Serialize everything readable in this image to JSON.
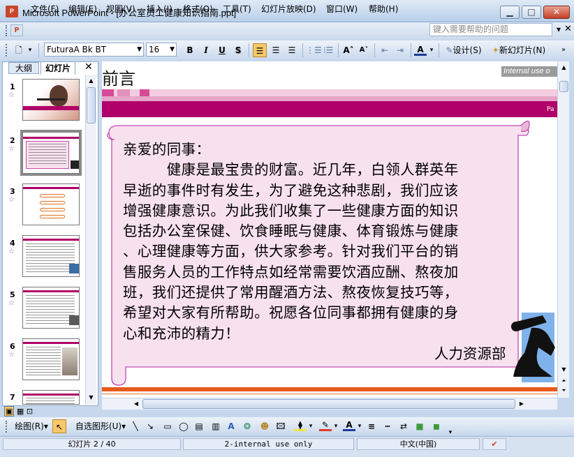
{
  "window": {
    "title": "Microsoft PowerPoint - [办公室员工健康知识指南.ppt]",
    "app_icon_text": "P",
    "btn_min": "▁",
    "btn_max": "□",
    "btn_close": "✕"
  },
  "menu": {
    "items": [
      "文件(F)",
      "编辑(E)",
      "视图(V)",
      "插入(I)",
      "格式(O)",
      "工具(T)",
      "幻灯片放映(D)",
      "窗口(W)",
      "帮助(H)"
    ],
    "help_placeholder": "键入需要帮助的问题"
  },
  "toolbar": {
    "font_name": "FuturaA Bk BT",
    "font_size": "16",
    "bold": "B",
    "italic": "I",
    "underline": "U",
    "shadow": "S",
    "design_label": "设计(S)",
    "new_slide_label": "新幻灯片(N)"
  },
  "left_pane": {
    "tab_outline": "大纲",
    "tab_slides": "幻灯片",
    "close": "✕",
    "slide_numbers": [
      "1",
      "2",
      "3",
      "4",
      "5",
      "6",
      "7"
    ]
  },
  "slide": {
    "title": "前言",
    "internal_label": "Internal use o",
    "page_mark": "Pa",
    "letter_lines": [
      "亲爱的同事：",
      "　　　健康是最宝贵的财富。近几年，白领人群英年",
      "早逝的事件时有发生，为了避免这种悲剧，我们应该",
      "增强健康意识。为此我们收集了一些健康方面的知识",
      "包括办公室保健、饮食睡眠与健康、体育锻炼与健康",
      "、心理健康等方面，供大家参考。针对我们平台的销",
      "售服务人员的工作特点如经常需要饮酒应酬、熬夜加",
      "班，我们还提供了常用醒酒方法、熬夜恢复技巧等，",
      "希望对大家有所帮助。祝愿各位同事都拥有健康的身",
      "心和充沛的精力！"
    ],
    "signature": "人力资源部",
    "colors": {
      "magenta": "#b10069",
      "scroll_fill": "#f8e1ef",
      "scroll_border": "#c44bb0",
      "orange": "#e85a1c"
    }
  },
  "drawbar": {
    "draw_label": "绘图(R)",
    "autoshapes_label": "自选图形(U)"
  },
  "status": {
    "slide_pos": "幻灯片 2 / 40",
    "design": "2-internal use only",
    "language": "中文(中国)"
  }
}
